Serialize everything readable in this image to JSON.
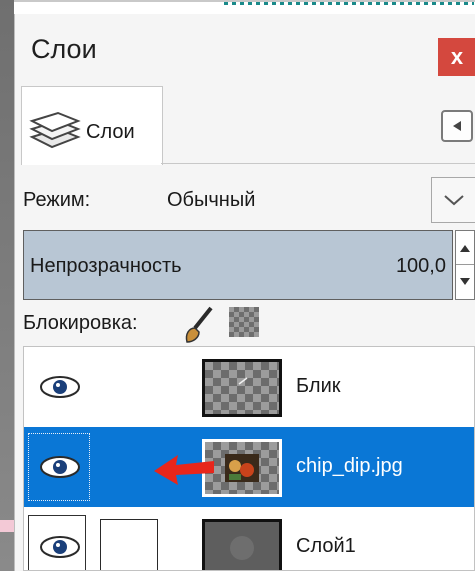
{
  "dock": {
    "title": "Слои",
    "close_label": "x"
  },
  "tab": {
    "label": "Слои",
    "icon": "layers-stack-icon"
  },
  "mode": {
    "label": "Режим:",
    "value": "Обычный"
  },
  "opacity": {
    "label": "Непрозрачность",
    "value": "100,0"
  },
  "lock": {
    "label": "Блокировка:"
  },
  "layers": [
    {
      "name": "Блик",
      "visible": true,
      "selected": false
    },
    {
      "name": "chip_dip.jpg",
      "visible": true,
      "selected": true
    },
    {
      "name": "Слой1",
      "visible": true,
      "selected": false
    }
  ],
  "colors": {
    "selection": "#0a77d6",
    "close": "#d4483e",
    "opacity_bg": "#b8c6d4",
    "annotation_arrow": "#e8261b"
  }
}
